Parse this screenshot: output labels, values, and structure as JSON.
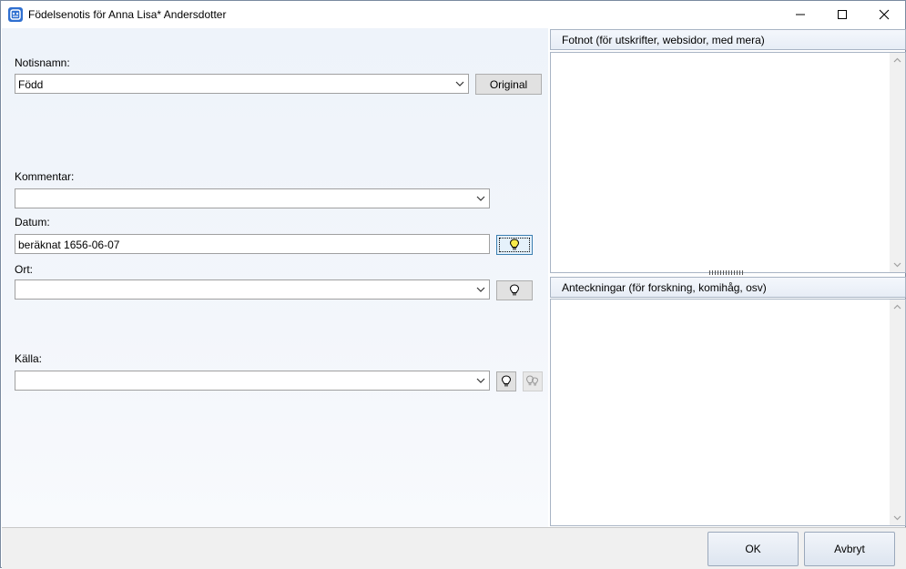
{
  "window": {
    "title": "Födelsenotis för Anna Lisa* Andersdotter"
  },
  "form": {
    "notisnamn_label": "Notisnamn:",
    "notisnamn_value": "Född",
    "original_button": "Original",
    "kommentar_label": "Kommentar:",
    "kommentar_value": "",
    "datum_label": "Datum:",
    "datum_value": "beräknat 1656-06-07",
    "ort_label": "Ort:",
    "ort_value": "",
    "kalla_label": "Källa:",
    "kalla_value": ""
  },
  "panels": {
    "fotnot_header": "Fotnot (för utskrifter, websidor, med mera)",
    "fotnot_text": "",
    "anteckningar_header": "Anteckningar (för forskning, komihåg, osv)",
    "anteckningar_text": ""
  },
  "buttons": {
    "ok": "OK",
    "cancel": "Avbryt"
  },
  "icons": {
    "app": "app-icon",
    "bulb": "lightbulb-icon",
    "bulb_multi": "multi-lightbulb-icon"
  },
  "colors": {
    "bulb_active": "#f7e94a",
    "accent": "#2f6fd0"
  }
}
